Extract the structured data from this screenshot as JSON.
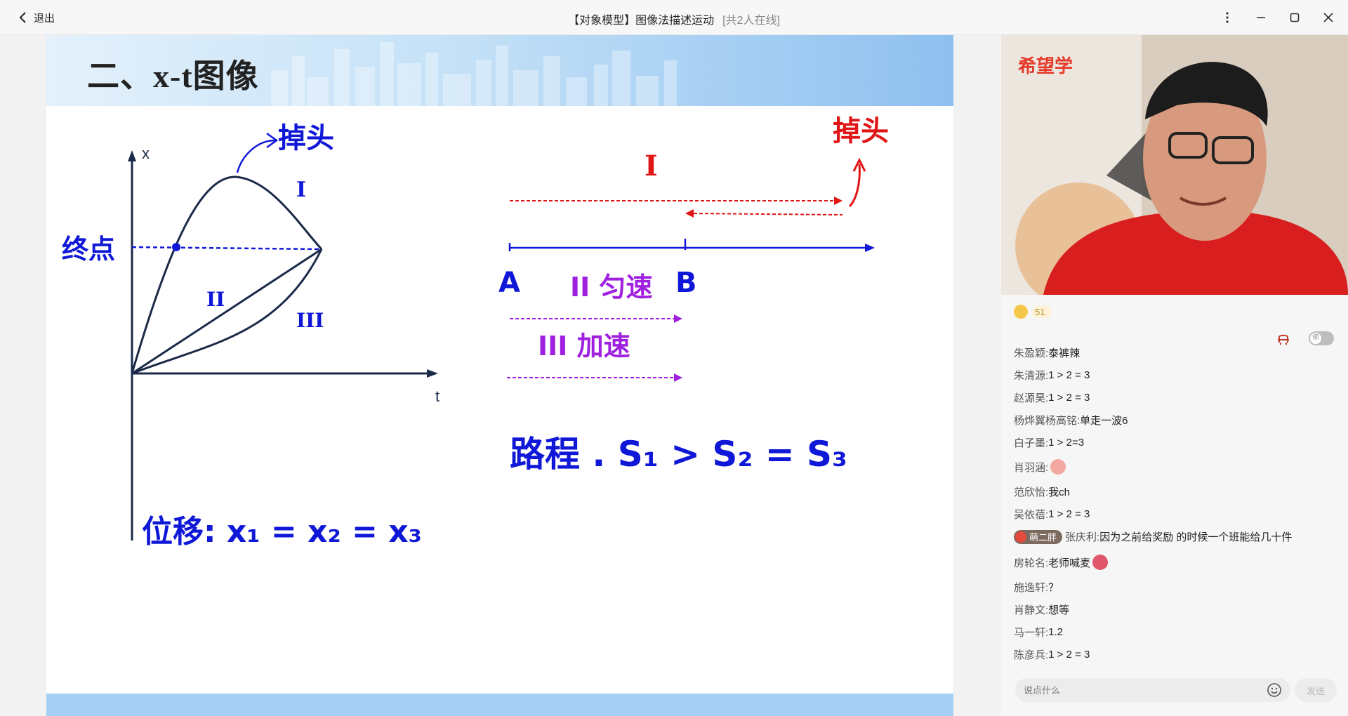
{
  "window": {
    "back_label": "退出",
    "title": "【对象模型】图像法描述运动",
    "online": "[共2人在线]"
  },
  "slide": {
    "title": "二、x-t图像"
  },
  "board": {
    "axis_x": "x",
    "axis_t": "t",
    "graph_turn": "掉头",
    "endpoint": "终点",
    "curve_1": "I",
    "curve_2": "II",
    "curve_3": "III",
    "displacement_eq": "位移: x₁ = x₂ = x₃",
    "motion_turn": "掉头",
    "motion_1": "I",
    "point_a": "A",
    "point_b": "B",
    "motion_2": "II 匀速",
    "motion_3": "III 加速",
    "distance_eq": "路程 . S₁ > S₂ = S₃"
  },
  "video": {
    "logo": "希望学"
  },
  "likes": {
    "count": "51"
  },
  "chat": {
    "role_toggle": "师",
    "messages": [
      {
        "nick": "朱盈颖: ",
        "text": "泰裤辣"
      },
      {
        "nick": "朱清源: ",
        "text": "1 > 2 = 3"
      },
      {
        "nick": "赵源昊: ",
        "text": "1 > 2 = 3"
      },
      {
        "nick": "杨烨翼杨高铭: ",
        "text": "单走一波6"
      },
      {
        "nick": "白子墨: ",
        "text": "1 > 2=3"
      },
      {
        "nick": "肖羽涵: ",
        "text": ""
      },
      {
        "nick": "范欣怡: ",
        "text": "我ch"
      },
      {
        "nick": "吴依蓓: ",
        "text": "1 > 2 = 3"
      },
      {
        "badge": "萌二胖",
        "nick": "张庆利: ",
        "text": "因为之前给奖励 的时候一个班能给几十件"
      },
      {
        "nick": "房轮名: ",
        "text": "老师喊麦"
      },
      {
        "nick": "施逸轩: ",
        "text": "？"
      },
      {
        "nick": "肖静文: ",
        "text": "想等"
      },
      {
        "nick": "马一轩: ",
        "text": "1.2"
      },
      {
        "nick": "陈彦兵: ",
        "text": "1 > 2 = 3"
      }
    ],
    "input_placeholder": "说点什么",
    "send_label": "发送"
  },
  "colors": {
    "ink_blue": "#1018d8",
    "ink_red": "#e01515",
    "ink_purple": "#a020e0",
    "axis": "#1b2a48"
  }
}
